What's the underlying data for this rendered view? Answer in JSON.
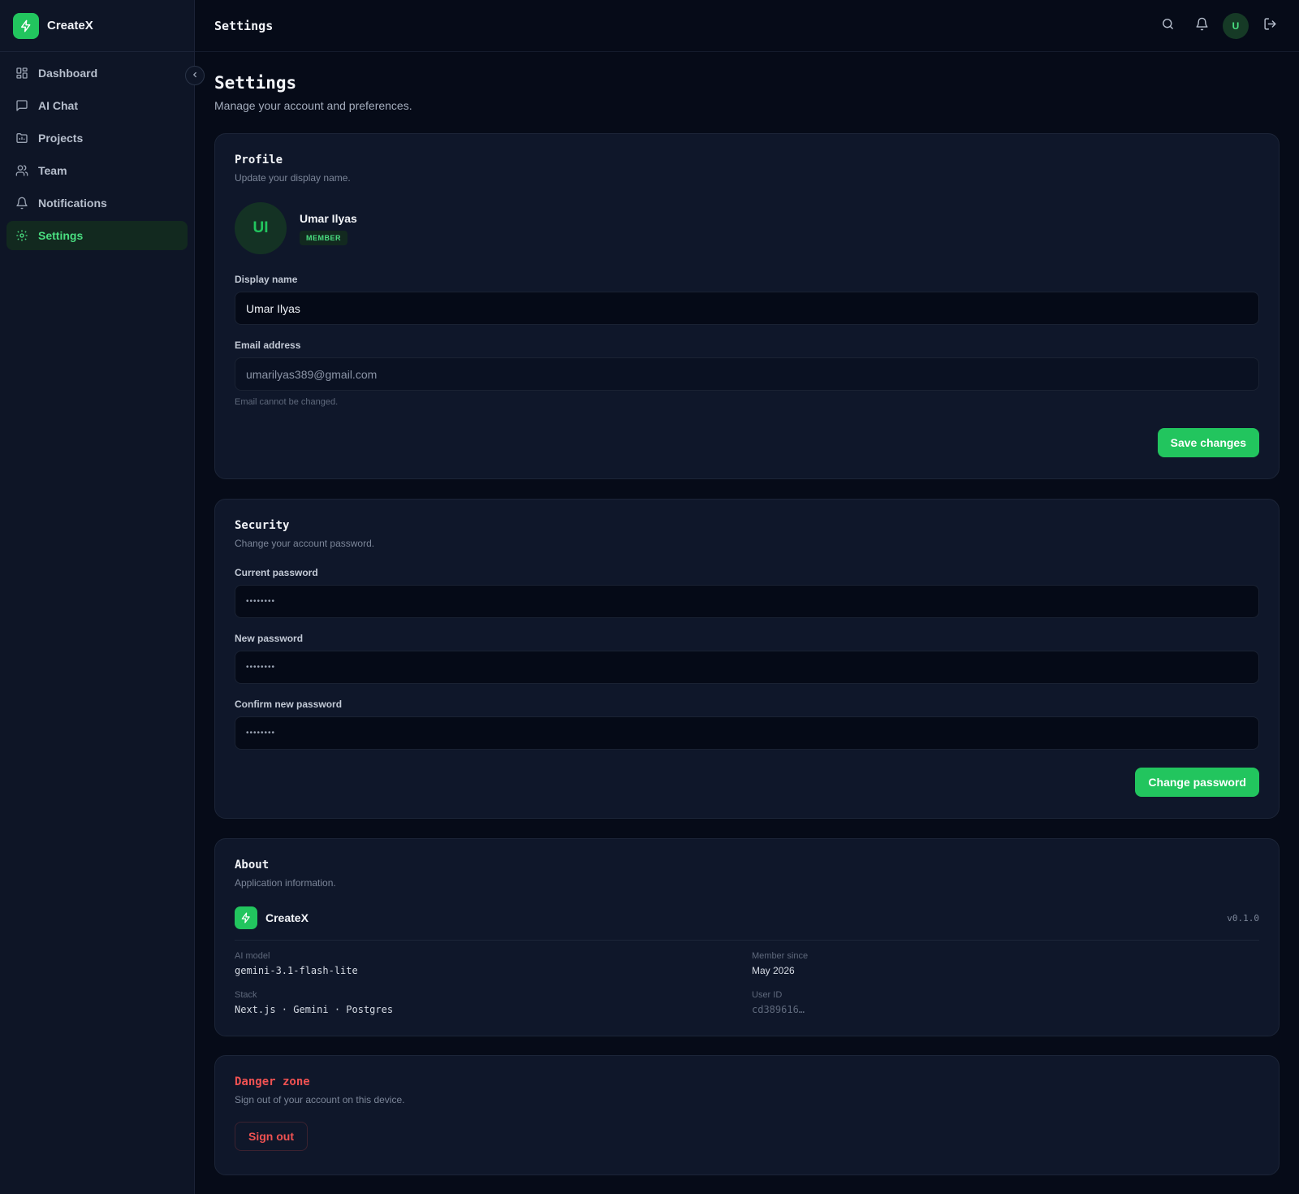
{
  "app": {
    "name": "CreateX"
  },
  "sidebar": {
    "items": [
      {
        "label": "Dashboard",
        "icon": "dashboard-icon"
      },
      {
        "label": "AI Chat",
        "icon": "chat-icon"
      },
      {
        "label": "Projects",
        "icon": "folder-icon"
      },
      {
        "label": "Team",
        "icon": "users-icon"
      },
      {
        "label": "Notifications",
        "icon": "bell-icon"
      },
      {
        "label": "Settings",
        "icon": "gear-icon",
        "active": true
      }
    ]
  },
  "topbar": {
    "title": "Settings",
    "avatar_initial": "U"
  },
  "page": {
    "title": "Settings",
    "subtitle": "Manage your account and preferences."
  },
  "profile": {
    "title": "Profile",
    "subtitle": "Update your display name.",
    "avatar_initials": "UI",
    "name": "Umar Ilyas",
    "role_badge": "MEMBER",
    "display_name_label": "Display name",
    "display_name_value": "Umar Ilyas",
    "email_label": "Email address",
    "email_value": "umarilyas389@gmail.com",
    "email_hint": "Email cannot be changed.",
    "save_label": "Save changes"
  },
  "security": {
    "title": "Security",
    "subtitle": "Change your account password.",
    "current_label": "Current password",
    "current_value": "••••••••",
    "new_label": "New password",
    "new_value": "••••••••",
    "confirm_label": "Confirm new password",
    "confirm_value": "••••••••",
    "change_label": "Change password"
  },
  "about": {
    "title": "About",
    "subtitle": "Application information.",
    "app_name": "CreateX",
    "version": "v0.1.0",
    "ai_model_label": "AI model",
    "ai_model_value": "gemini-3.1-flash-lite",
    "member_since_label": "Member since",
    "member_since_value": "May 2026",
    "stack_label": "Stack",
    "stack_value": "Next.js · Gemini · Postgres",
    "user_id_label": "User ID",
    "user_id_value": "cd389616…"
  },
  "danger": {
    "title": "Danger zone",
    "subtitle": "Sign out of your account on this device.",
    "signout_label": "Sign out"
  },
  "colors": {
    "accent": "#22c55e",
    "danger": "#f05252",
    "background": "#060b18",
    "card": "#0f172a"
  }
}
